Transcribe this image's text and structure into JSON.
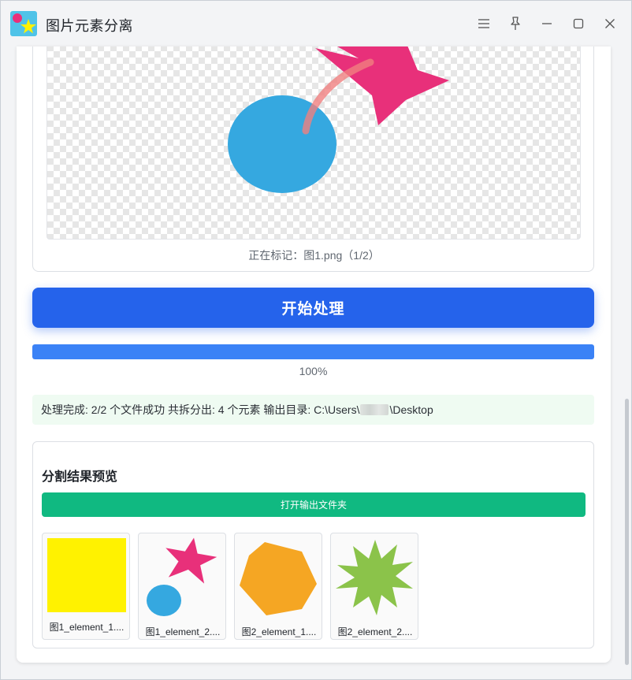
{
  "window": {
    "title": "图片元素分离",
    "controls": [
      "menu-icon",
      "pin-icon",
      "minimize-icon",
      "maximize-icon",
      "close-icon"
    ]
  },
  "canvas": {
    "marking_status": "正在标记：图1.png（1/2）",
    "shapes": [
      {
        "shape": "ellipse",
        "color": "#35a8e0"
      },
      {
        "shape": "star",
        "color": "#e8307a"
      },
      {
        "shape": "stroke",
        "color": "#f08080"
      }
    ]
  },
  "actions": {
    "start_label": "开始处理"
  },
  "progress": {
    "percent": 100,
    "text": "100%"
  },
  "result": {
    "message_prefix": "处理完成: 2/2 个文件成功 共拆分出: 4 个元素 输出目录: C:\\Users\\",
    "message_suffix": "\\Desktop"
  },
  "preview": {
    "title": "分割结果预览",
    "open_folder_label": "打开输出文件夹",
    "items": [
      {
        "label": "图1_element_1....",
        "shape": "square",
        "color": "#fff200"
      },
      {
        "label": "图1_element_2....",
        "shape": "star-and-circle",
        "colors": [
          "#e8307a",
          "#35a8e0"
        ]
      },
      {
        "label": "图2_element_1....",
        "shape": "hexagon",
        "color": "#f5a623"
      },
      {
        "label": "图2_element_2....",
        "shape": "burst-star",
        "color": "#8bc34a"
      }
    ]
  },
  "colors": {
    "primary": "#2563eb",
    "progress": "#3b82f6",
    "success_button": "#10b981",
    "success_bg": "#effbf2"
  }
}
